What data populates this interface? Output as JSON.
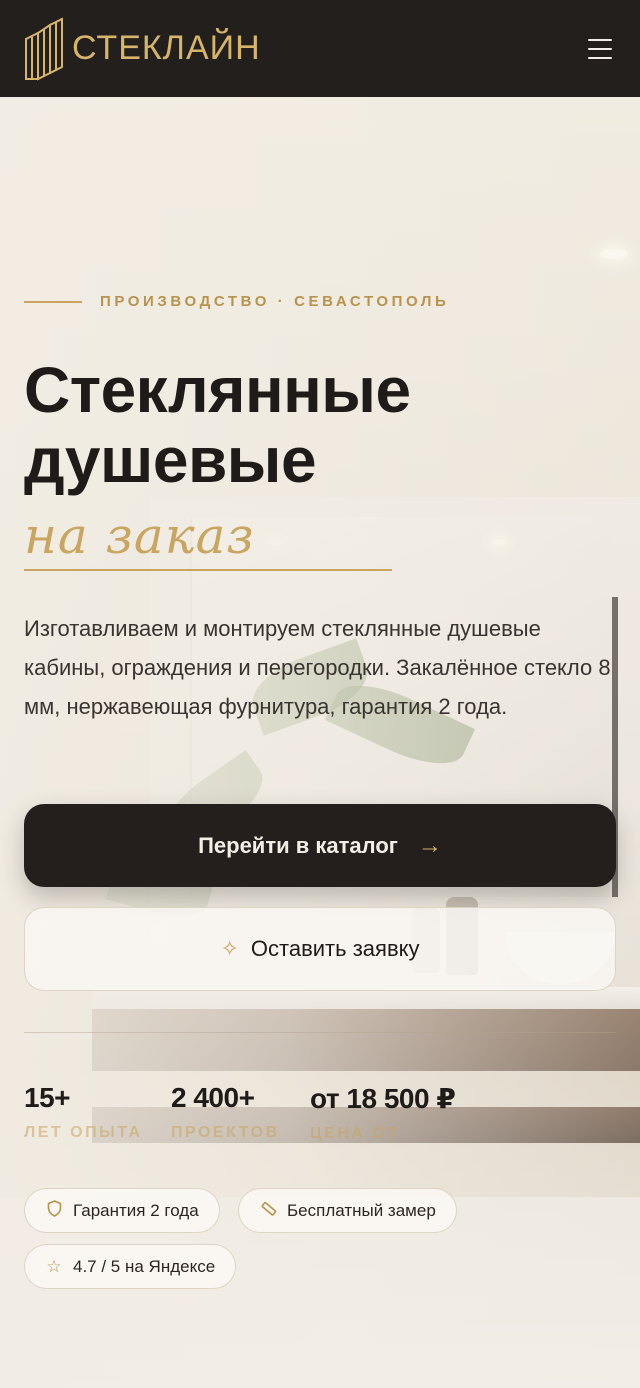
{
  "header": {
    "logo_text": "СТЕКЛАЙН",
    "logo_icon": "glass-panels-logo",
    "menu_icon": "hamburger-icon"
  },
  "hero": {
    "eyebrow": "ПРОИЗВОДСТВО · СЕВАСТОПОЛЬ",
    "title_line1": "Стеклянные",
    "title_line2": "душевые",
    "title_accent": "на заказ",
    "description": "Изготавливаем и монтируем стеклянные душевые кабины, ограждения и перегородки. Закалённое стекло 8 мм, нержавеющая фурнитура, гарантия 2 года.",
    "primary_button": "Перейти в каталог",
    "primary_icon": "arrow-right-icon",
    "secondary_button": "Оставить заявку",
    "secondary_icon": "sparkle-icon"
  },
  "stats": [
    {
      "value": "15+",
      "label": "ЛЕТ ОПЫТА"
    },
    {
      "value": "2 400+",
      "label": "ПРОЕКТОВ"
    },
    {
      "value": "от 18 500 ₽",
      "label": "ЦЕНА ОТ"
    }
  ],
  "chips": [
    {
      "label": "Гарантия 2 года",
      "icon": "shield-icon"
    },
    {
      "label": "Бесплатный замер",
      "icon": "ruler-icon"
    },
    {
      "label": "4.7 / 5 на Яндексе",
      "icon": "star-icon"
    }
  ],
  "colors": {
    "accent": "#c9a560",
    "dark": "#231f1c",
    "text": "#1f1b18",
    "background": "#f1ece1"
  }
}
